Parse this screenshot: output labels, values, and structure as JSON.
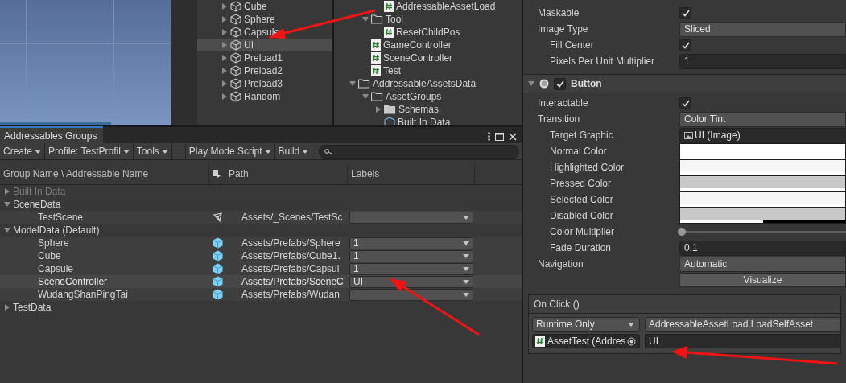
{
  "hierarchy": {
    "items": [
      {
        "label": "Cube",
        "expanded": false,
        "selected": false
      },
      {
        "label": "Sphere",
        "expanded": false,
        "selected": false
      },
      {
        "label": "Capsule",
        "expanded": false,
        "selected": false
      },
      {
        "label": "UI",
        "expanded": false,
        "selected": true
      },
      {
        "label": "Preload1",
        "expanded": false,
        "selected": false
      },
      {
        "label": "Preload2",
        "expanded": false,
        "selected": false
      },
      {
        "label": "Preload3",
        "expanded": false,
        "selected": false
      },
      {
        "label": "Random",
        "expanded": false,
        "selected": false
      }
    ]
  },
  "project": {
    "tree": [
      {
        "children": [
          {
            "children": [
              {
                "label": "AddressableAssetLoad",
                "kind": "script"
              }
            ]
          },
          {
            "label": "Tool",
            "kind": "folder",
            "expanded": true,
            "children": [
              {
                "label": "ResetChildPos",
                "kind": "script"
              }
            ]
          },
          {
            "label": "GameController",
            "kind": "script"
          },
          {
            "label": "SceneController",
            "kind": "script"
          },
          {
            "label": "Test",
            "kind": "script"
          }
        ]
      },
      {
        "label": "AddressableAssetsData",
        "kind": "folder",
        "expanded": true,
        "children": [
          {
            "label": "AssetGroups",
            "kind": "folder",
            "expanded": true,
            "children": [
              {
                "label": "Schemas",
                "kind": "folder",
                "expanded": false
              },
              {
                "label": "Built In Data",
                "kind": "asset"
              }
            ]
          }
        ]
      }
    ]
  },
  "addressables": {
    "tab": "Addressables Groups",
    "toolbar_left": [
      "Create",
      "Profile: TestProfil",
      "Tools"
    ],
    "toolbar_right": [
      "Play Mode Script",
      "Build"
    ],
    "columns": [
      "Group Name \\ Addressable Name",
      "Path",
      "Labels"
    ],
    "groups": [
      {
        "name": "Built In Data",
        "expanded": false,
        "disabled": true
      },
      {
        "name": "SceneData",
        "expanded": true,
        "disabled": false,
        "entries": [
          {
            "name": "TestScene",
            "kind": "scene",
            "path": "Assets/_Scenes/TestSc",
            "selected": false
          }
        ]
      },
      {
        "name": "ModelData (Default)",
        "expanded": true,
        "disabled": false,
        "entries": [
          {
            "name": "Sphere",
            "kind": "prefab",
            "path": "Assets/Prefabs/Sphere",
            "label": "1",
            "selected": false
          },
          {
            "name": "Cube",
            "kind": "prefab",
            "path": "Assets/Prefabs/Cube1.",
            "label": "1",
            "selected": false
          },
          {
            "name": "Capsule",
            "kind": "prefab",
            "path": "Assets/Prefabs/Capsul",
            "label": "1",
            "selected": false
          },
          {
            "name": "SceneController",
            "kind": "prefab",
            "path": "Assets/Prefabs/SceneC",
            "label": "UI",
            "selected": true
          },
          {
            "name": "WudangShanPingTai",
            "kind": "prefab",
            "path": "Assets/Prefabs/Wudan",
            "selected": false
          }
        ]
      },
      {
        "name": "TestData",
        "expanded": false,
        "disabled": false
      }
    ]
  },
  "inspector": {
    "rows": [
      {
        "kind": "check",
        "label": "Maskable",
        "checked": true
      },
      {
        "kind": "dropdown",
        "label": "Image Type",
        "value": "Sliced",
        "children": [
          {
            "kind": "check",
            "label": "Fill Center",
            "checked": true
          },
          {
            "kind": "field",
            "label": "Pixels Per Unit Multiplier",
            "value": "1"
          }
        ]
      }
    ],
    "component": {
      "title": "Button",
      "enabled": true,
      "expanded": true
    },
    "component_rows": [
      {
        "kind": "check",
        "label": "Interactable",
        "checked": true
      },
      {
        "kind": "dropdown",
        "label": "Transition",
        "value": "Color Tint",
        "children": [
          {
            "kind": "object",
            "label": "Target Graphic",
            "value": "UI (Image)"
          },
          {
            "kind": "color",
            "label": "Normal Color",
            "color": "#ffffff",
            "level": 1
          },
          {
            "kind": "color",
            "label": "Highlighted Color",
            "color": "#f5f5f5",
            "level": 1
          },
          {
            "kind": "color",
            "label": "Pressed Color",
            "color": "#c8c8c8",
            "level": 1
          },
          {
            "kind": "color",
            "label": "Selected Color",
            "color": "#f5f5f5",
            "level": 1
          },
          {
            "kind": "color",
            "label": "Disabled Color",
            "color": "#c8c8c8",
            "level": 0.5
          },
          {
            "kind": "slider",
            "label": "Color Multiplier",
            "level": 0
          },
          {
            "kind": "field",
            "label": "Fade Duration",
            "value": "0.1"
          }
        ]
      },
      {
        "kind": "dropdown",
        "label": "Navigation",
        "value": "Automatic"
      },
      {
        "kind": "button",
        "value": "Visualize"
      }
    ],
    "on_click": {
      "title": "On Click ()",
      "mode": "Runtime Only",
      "function": "AddressableAssetLoad.LoadSelfAsset",
      "object": "AssetTest (Addres",
      "argument": "UI"
    }
  }
}
